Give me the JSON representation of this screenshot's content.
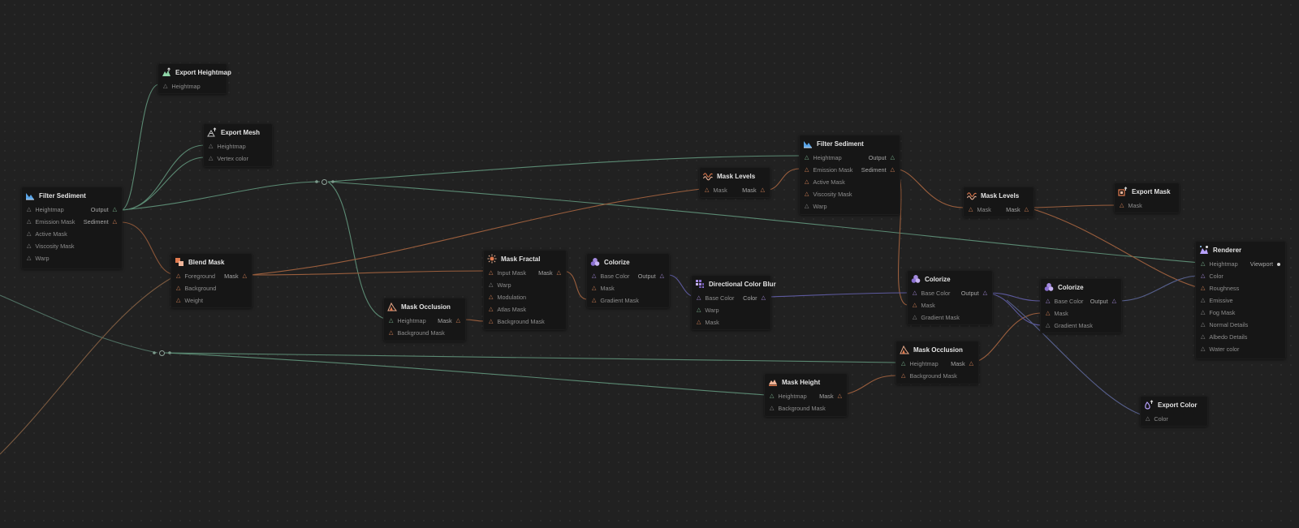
{
  "colors": {
    "height_wire": "#5f8f78",
    "mask_wire": "#a8653f",
    "color_wire": "#6b66b8",
    "icon_filter": "#5aa5e8",
    "icon_export": "#8fd6a8",
    "icon_levels": "#e07a4f",
    "icon_colorize": "#a58be0",
    "icon_renderer": "#b8a2ff"
  },
  "nodes": [
    {
      "id": "export-heightmap",
      "title": "Export Heightmap",
      "icon": "export-heightmap-icon",
      "inputs": [
        {
          "label": "Heightmap",
          "t": "grey"
        }
      ],
      "outputs": []
    },
    {
      "id": "export-mesh",
      "title": "Export Mesh",
      "icon": "export-mesh-icon",
      "inputs": [
        {
          "label": "Heightmap",
          "t": "grey"
        },
        {
          "label": "Vertex color",
          "t": "grey"
        }
      ],
      "outputs": []
    },
    {
      "id": "filter-sediment-1",
      "title": "Filter Sediment",
      "icon": "filter-sediment-icon",
      "inputs": [
        {
          "label": "Heightmap",
          "t": "grey"
        },
        {
          "label": "Emission Mask",
          "t": "grey"
        },
        {
          "label": "Active Mask",
          "t": "grey"
        },
        {
          "label": "Viscosity Mask",
          "t": "grey"
        },
        {
          "label": "Warp",
          "t": "grey"
        }
      ],
      "outputs": [
        {
          "label": "Output",
          "t": "green"
        },
        {
          "label": "Sediment",
          "t": "orange"
        }
      ]
    },
    {
      "id": "blend-mask",
      "title": "Blend Mask",
      "icon": "blend-mask-icon",
      "inputs": [
        {
          "label": "Foreground",
          "t": "orange"
        },
        {
          "label": "Background",
          "t": "orange"
        },
        {
          "label": "Weight",
          "t": "orange"
        }
      ],
      "outputs": [
        {
          "label": "Mask",
          "t": "orange"
        }
      ]
    },
    {
      "id": "mask-occlusion-1",
      "title": "Mask Occlusion",
      "icon": "mask-occlusion-icon",
      "inputs": [
        {
          "label": "Heightmap",
          "t": "green"
        },
        {
          "label": "Background Mask",
          "t": "orange"
        }
      ],
      "outputs": [
        {
          "label": "Mask",
          "t": "orange"
        }
      ]
    },
    {
      "id": "mask-fractal",
      "title": "Mask Fractal",
      "icon": "mask-fractal-icon",
      "inputs": [
        {
          "label": "Input Mask",
          "t": "orange"
        },
        {
          "label": "Warp",
          "t": "grey"
        },
        {
          "label": "Modulation",
          "t": "orange"
        },
        {
          "label": "Atlas Mask",
          "t": "orange"
        },
        {
          "label": "Background Mask",
          "t": "orange"
        }
      ],
      "outputs": [
        {
          "label": "Mask",
          "t": "orange"
        }
      ]
    },
    {
      "id": "colorize-1",
      "title": "Colorize",
      "icon": "colorize-icon",
      "inputs": [
        {
          "label": "Base Color",
          "t": "purple"
        },
        {
          "label": "Mask",
          "t": "orange"
        },
        {
          "label": "Gradient Mask",
          "t": "orange"
        }
      ],
      "outputs": [
        {
          "label": "Output",
          "t": "purple"
        }
      ]
    },
    {
      "id": "directional-color-blur",
      "title": "Directional Color Blur",
      "icon": "directional-blur-icon",
      "inputs": [
        {
          "label": "Base Color",
          "t": "purple"
        },
        {
          "label": "Warp",
          "t": "grey"
        },
        {
          "label": "Mask",
          "t": "orange"
        }
      ],
      "outputs": [
        {
          "label": "Color",
          "t": "purple"
        }
      ]
    },
    {
      "id": "mask-levels-1",
      "title": "Mask Levels",
      "icon": "mask-levels-icon",
      "inputs": [
        {
          "label": "Mask",
          "t": "orange"
        }
      ],
      "outputs": [
        {
          "label": "Mask",
          "t": "orange"
        }
      ]
    },
    {
      "id": "filter-sediment-2",
      "title": "Filter Sediment",
      "icon": "filter-sediment-icon",
      "inputs": [
        {
          "label": "Heightmap",
          "t": "green"
        },
        {
          "label": "Emission Mask",
          "t": "orange"
        },
        {
          "label": "Active Mask",
          "t": "grey"
        },
        {
          "label": "Viscosity Mask",
          "t": "grey"
        },
        {
          "label": "Warp",
          "t": "grey"
        }
      ],
      "outputs": [
        {
          "label": "Output",
          "t": "green"
        },
        {
          "label": "Sediment",
          "t": "orange"
        }
      ]
    },
    {
      "id": "mask-levels-2",
      "title": "Mask Levels",
      "icon": "mask-levels-icon",
      "inputs": [
        {
          "label": "Mask",
          "t": "orange"
        }
      ],
      "outputs": [
        {
          "label": "Mask",
          "t": "orange"
        }
      ]
    },
    {
      "id": "export-mask",
      "title": "Export Mask",
      "icon": "export-mask-icon",
      "inputs": [
        {
          "label": "Mask",
          "t": "orange"
        }
      ],
      "outputs": []
    },
    {
      "id": "colorize-2",
      "title": "Colorize",
      "icon": "colorize-icon",
      "inputs": [
        {
          "label": "Base Color",
          "t": "purple"
        },
        {
          "label": "Mask",
          "t": "orange"
        },
        {
          "label": "Gradient Mask",
          "t": "grey"
        }
      ],
      "outputs": [
        {
          "label": "Output",
          "t": "purple"
        }
      ]
    },
    {
      "id": "colorize-3",
      "title": "Colorize",
      "icon": "colorize-icon",
      "inputs": [
        {
          "label": "Base Color",
          "t": "purple"
        },
        {
          "label": "Mask",
          "t": "orange"
        },
        {
          "label": "Gradient Mask",
          "t": "grey"
        }
      ],
      "outputs": [
        {
          "label": "Output",
          "t": "purple"
        }
      ]
    },
    {
      "id": "mask-occlusion-2",
      "title": "Mask Occlusion",
      "icon": "mask-occlusion-icon",
      "inputs": [
        {
          "label": "Heightmap",
          "t": "green"
        },
        {
          "label": "Background Mask",
          "t": "orange"
        }
      ],
      "outputs": [
        {
          "label": "Mask",
          "t": "orange"
        }
      ]
    },
    {
      "id": "mask-height",
      "title": "Mask Height",
      "icon": "mask-height-icon",
      "inputs": [
        {
          "label": "Heightmap",
          "t": "green"
        },
        {
          "label": "Background Mask",
          "t": "grey"
        }
      ],
      "outputs": [
        {
          "label": "Mask",
          "t": "orange"
        }
      ]
    },
    {
      "id": "renderer",
      "title": "Renderer",
      "icon": "renderer-icon",
      "inputs": [
        {
          "label": "Heightmap",
          "t": "green"
        },
        {
          "label": "Color",
          "t": "purple"
        },
        {
          "label": "Roughness",
          "t": "orange"
        },
        {
          "label": "Emissive",
          "t": "grey"
        },
        {
          "label": "Fog Mask",
          "t": "grey"
        },
        {
          "label": "Normal Details",
          "t": "grey"
        },
        {
          "label": "Albedo Details",
          "t": "grey"
        },
        {
          "label": "Water color",
          "t": "grey"
        }
      ],
      "outputs": [
        {
          "label": "Viewport",
          "t": "dot"
        }
      ]
    },
    {
      "id": "export-color",
      "title": "Export Color",
      "icon": "export-color-icon",
      "inputs": [
        {
          "label": "Color",
          "t": "grey"
        }
      ],
      "outputs": []
    }
  ]
}
